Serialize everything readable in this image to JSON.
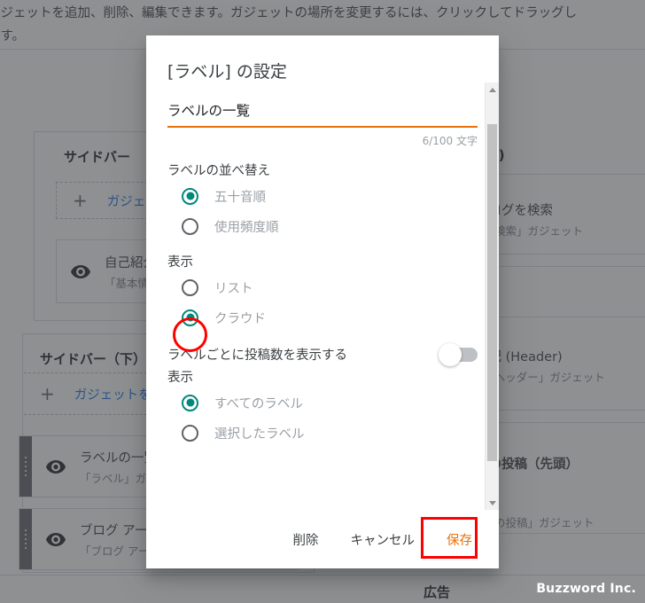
{
  "background": {
    "help_text_line1": "ガジェットを追加、削除、編集できます。ガジェットの場所を変更するには、クリックしてドラッグし",
    "help_text_line2": "ます。",
    "sections": [
      {
        "title": "サイドバー"
      },
      {
        "title": "サイドバー（下）"
      }
    ],
    "add_gadget_label": "ガジェットを追加",
    "add_plus_icon": "plus-icon",
    "eye_icon": "eye-icon",
    "gadgets_left": [
      {
        "name": "自己紹介",
        "sub": "「基本情報」ガジェット"
      },
      {
        "name": "ラベルの一覧",
        "sub": "「ラベル」ガジェット"
      },
      {
        "name": "ブログ アーカイブ",
        "sub": "「ブログ アーカイブ」ガジェット"
      }
    ],
    "gadgets_right": [
      {
        "name": "このブログを検索",
        "sub": "「ブログ検索」ガジェット"
      },
      {
        "name": "散歩日記 (Header)",
        "sub": "「ページヘッダー」ガジェット"
      },
      {
        "name": "ブログの投稿（先頭）",
        "sub": "「ブログの投稿」ガジェット"
      }
    ],
    "right_partial_header": "b)",
    "ad_label": "広告",
    "watermark": "Buzzword Inc."
  },
  "dialog": {
    "title": "[ラベル] の設定",
    "name_field": {
      "value": "ラベルの一覧",
      "counter": "6/100 文字",
      "accent_color": "#e8710a"
    },
    "sort_group": {
      "label": "ラベルの並べ替え",
      "options": [
        {
          "label": "五十音順",
          "selected": true
        },
        {
          "label": "使用頻度順",
          "selected": false
        }
      ]
    },
    "display_group": {
      "label": "表示",
      "options": [
        {
          "label": "リスト",
          "selected": false
        },
        {
          "label": "クラウド",
          "selected": true
        }
      ]
    },
    "show_count_switch": {
      "label": "ラベルごとに投稿数を表示する",
      "state": "off"
    },
    "label_scope_group": {
      "label": "表示",
      "options": [
        {
          "label": "すべてのラベル",
          "selected": true
        },
        {
          "label": "選択したラベル",
          "selected": false
        }
      ]
    },
    "footer": {
      "delete_label": "削除",
      "cancel_label": "キャンセル",
      "save_label": "保存"
    },
    "scrollbar": {
      "up_arrow_icon": "caret-up-icon",
      "down_arrow_icon": "caret-down-icon"
    },
    "radio_selected_color": "#00897b"
  },
  "annotations": {
    "color": "#ff0000",
    "circle_target": "クラウド",
    "box_target": "保存"
  }
}
